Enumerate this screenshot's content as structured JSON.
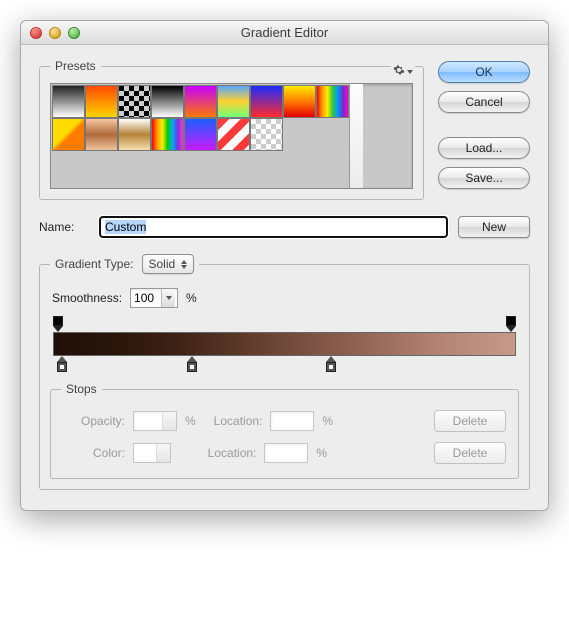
{
  "window": {
    "title": "Gradient Editor"
  },
  "buttons": {
    "ok": "OK",
    "cancel": "Cancel",
    "load": "Load...",
    "save": "Save...",
    "new": "New"
  },
  "presets": {
    "legend": "Presets"
  },
  "name": {
    "label": "Name:",
    "value": "Custom"
  },
  "gradtype": {
    "legend": "Gradient Type:",
    "value": "Solid"
  },
  "smoothness": {
    "label": "Smoothness:",
    "value": "100",
    "unit": "%"
  },
  "stops": {
    "legend": "Stops",
    "opacity_label": "Opacity:",
    "color_label": "Color:",
    "location_label": "Location:",
    "pct": "%",
    "delete": "Delete"
  },
  "gradient": {
    "opacity_stops_pct": [
      0,
      100
    ],
    "color_stops_pct": [
      2,
      30,
      60
    ]
  }
}
